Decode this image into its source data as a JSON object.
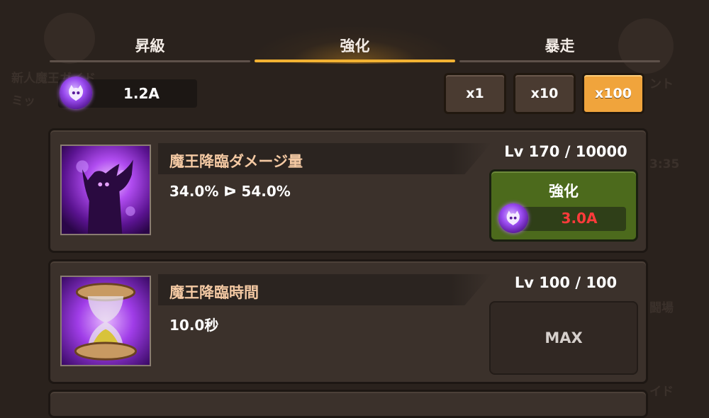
{
  "background_texts": {
    "guide": "新人魔王ガイド",
    "mission": "ミッ",
    "event": "ント",
    "timer": "3:35",
    "arena": "闘場",
    "guide2": "イド"
  },
  "tabs": [
    {
      "label": "昇級",
      "active": false
    },
    {
      "label": "強化",
      "active": true
    },
    {
      "label": "暴走",
      "active": false
    }
  ],
  "currency": {
    "value": "1.2A",
    "icon": "demon-gem-icon"
  },
  "multipliers": [
    {
      "label": "x1",
      "active": false
    },
    {
      "label": "x10",
      "active": false
    },
    {
      "label": "x100",
      "active": true
    }
  ],
  "skills": [
    {
      "title": "魔王降臨ダメージ量",
      "value": "34.0% ᐅ 54.0%",
      "level": "Lv 170 / 10000",
      "button_label": "強化",
      "cost": "3.0A",
      "icon": "demon-silhouette-icon"
    },
    {
      "title": "魔王降臨時間",
      "value": "10.0秒",
      "level": "Lv 100 / 100",
      "status": "MAX",
      "icon": "hourglass-icon"
    }
  ],
  "colors": {
    "accent_tab": "#f2b233",
    "active_multiplier": "#f0a43c",
    "upgrade_button": "#4c6a1c",
    "cost_text": "#ff3b3b",
    "title_text": "#f4c9a3"
  }
}
